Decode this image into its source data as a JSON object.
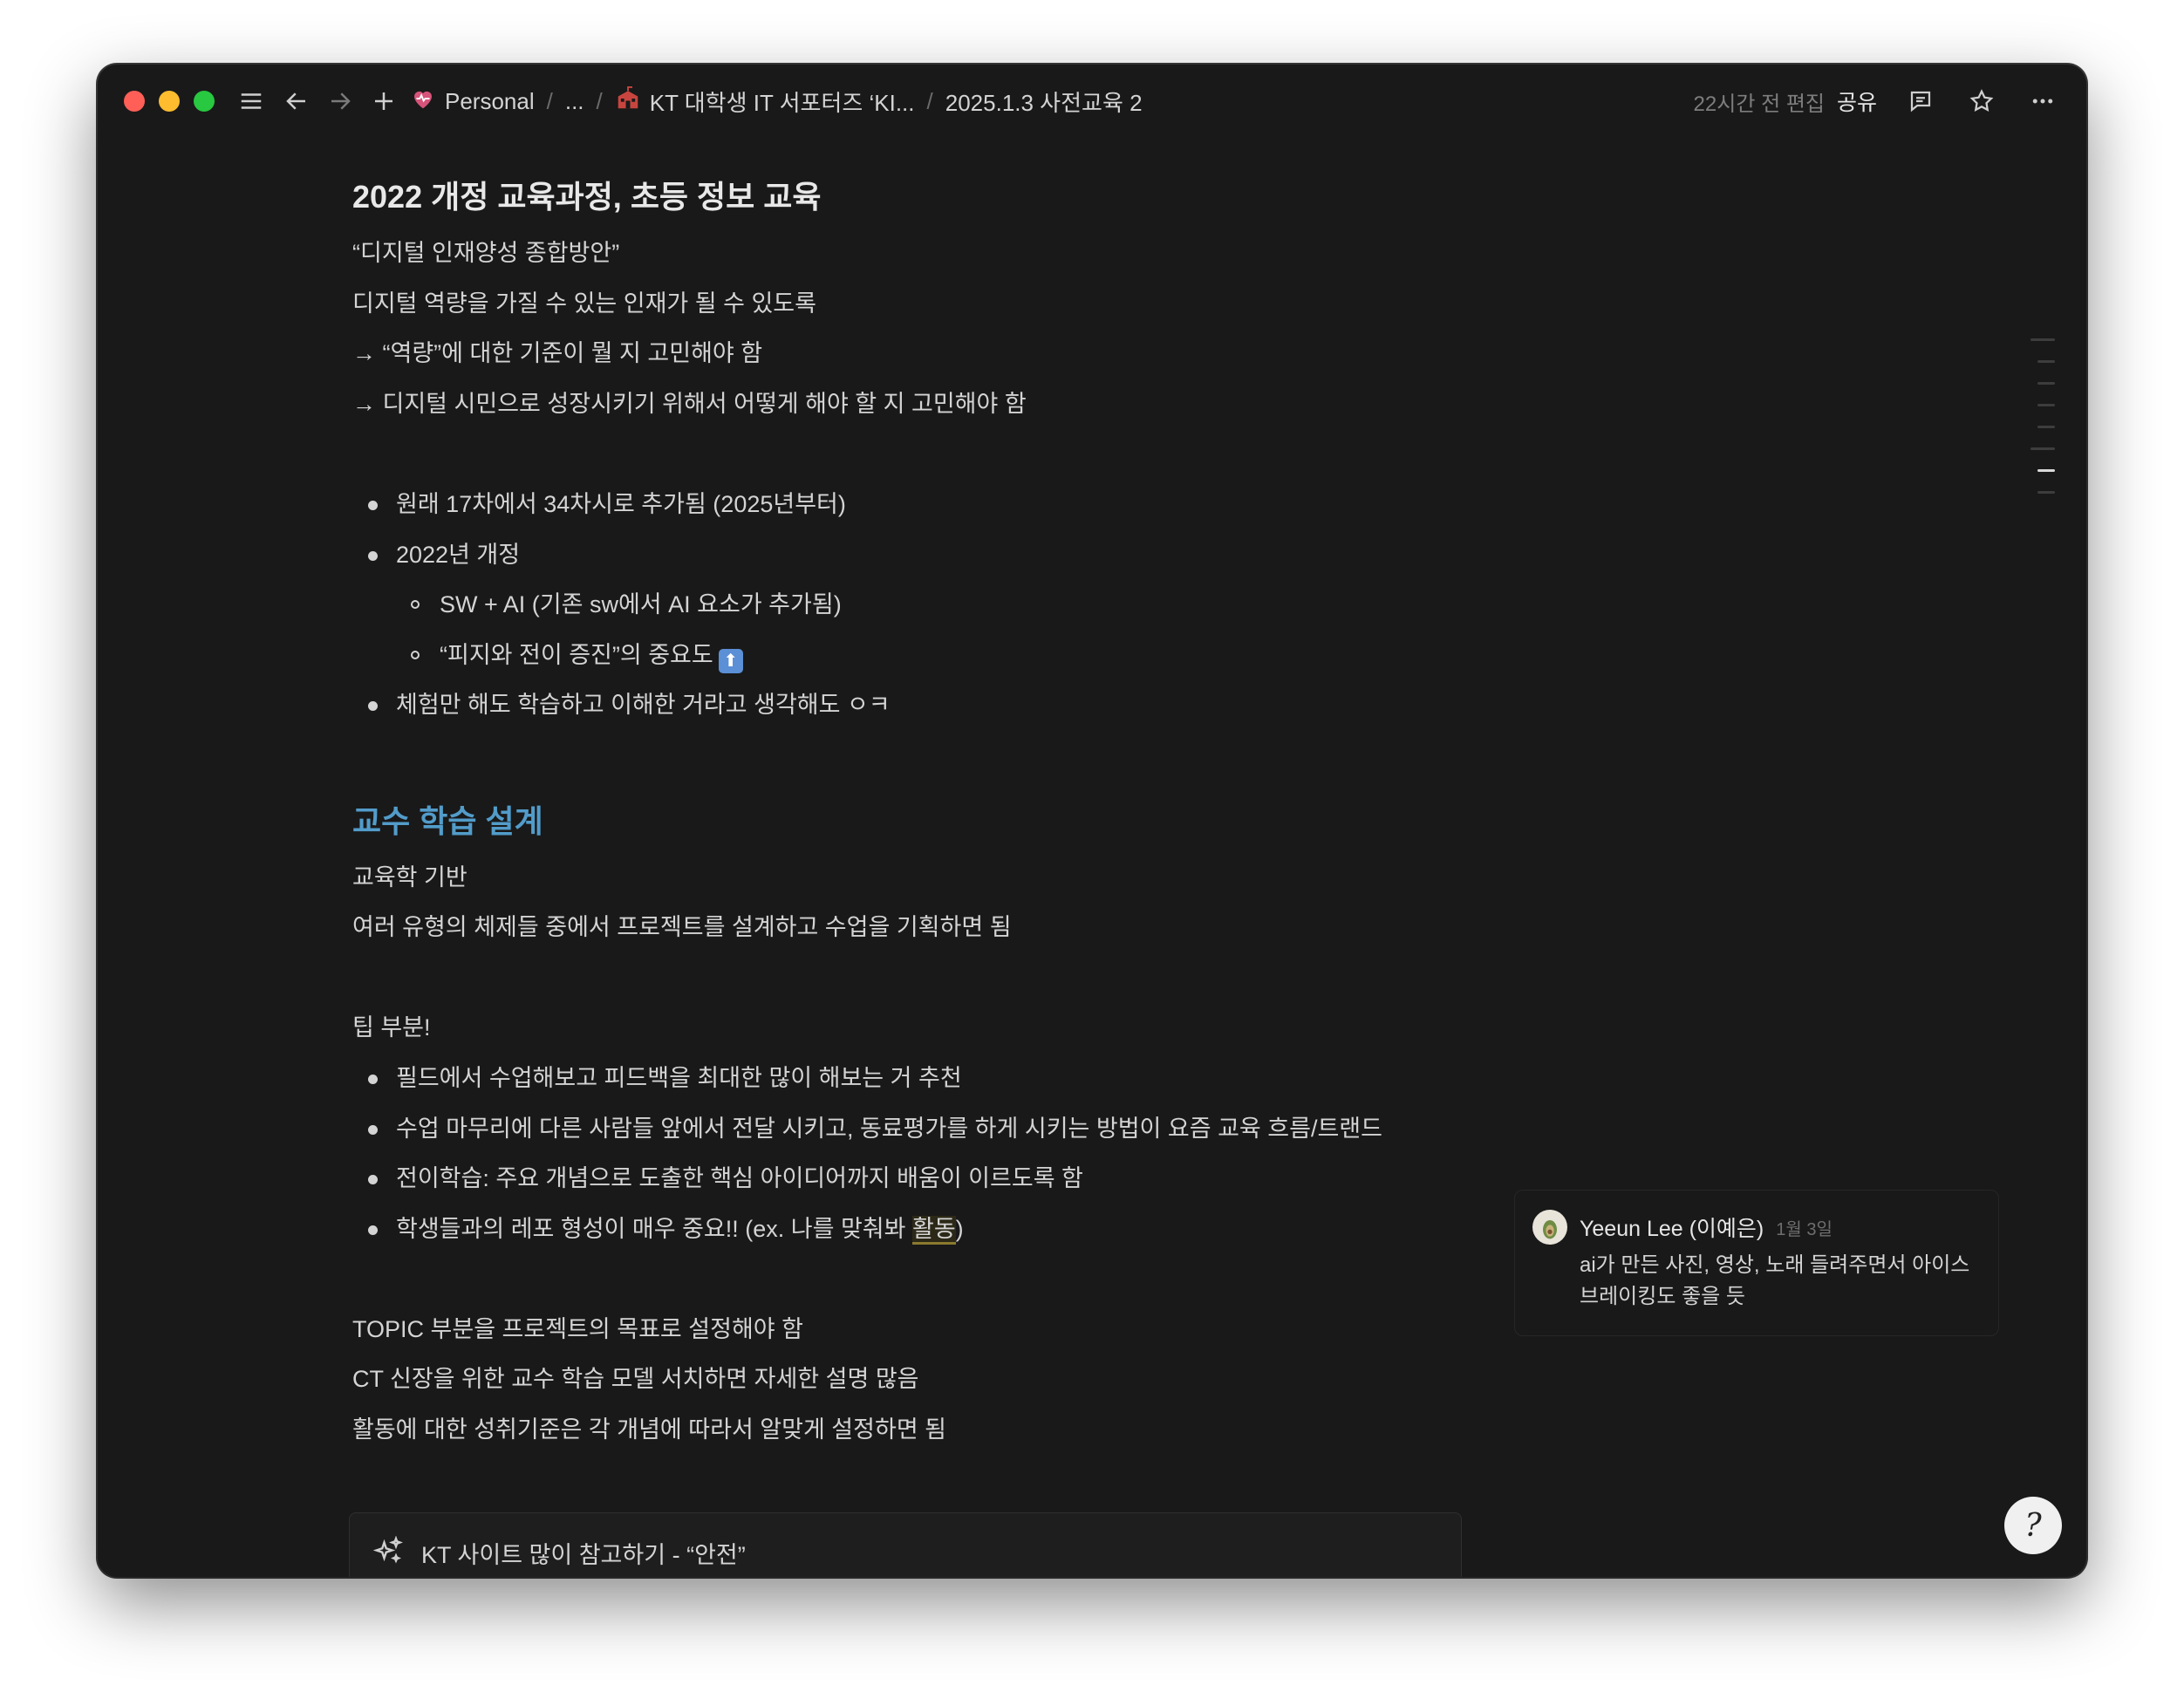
{
  "titlebar": {
    "breadcrumb": {
      "workspace": "Personal",
      "ellipsis": "...",
      "parent": "KT 대학생 IT 서포터즈 ‘KI...",
      "current": "2025.1.3 사전교육 2"
    },
    "edited": "22시간 전 편집",
    "share": "공유",
    "icons": [
      "menu-icon",
      "back-arrow-icon",
      "forward-arrow-icon",
      "plus-icon",
      "heart-icon",
      "school-icon",
      "comment-icon",
      "star-icon",
      "more-icon"
    ]
  },
  "doc": {
    "heading1": "2022 개정 교육과정, 초등 정보 교육",
    "lines1": [
      "“디지털 인재양성 종합방안”",
      "디지털 역량을 가질 수 있는 인재가 될 수 있도록",
      "→ “역량”에 대한 기준이 뭘 지 고민해야 함",
      "→ 디지털 시민으로 성장시키기 위해서 어떻게 해야 할 지 고민해야 함"
    ],
    "bullets1": {
      "b1": "원래 17차에서 34차시로 추가됨 (2025년부터)",
      "b2": "2022년 개정",
      "sub1": "SW + AI (기존 sw에서 AI 요소가 추가됨)",
      "sub2": "“피지와 전이 증진”의 중요도",
      "sub2_emoji": "⬆",
      "b3": "체험만 해도 학습하고 이해한 거라고 생각해도 ㅇㅋ"
    },
    "heading2": "교수 학습 설계",
    "lines2": [
      "교육학 기반",
      "여러 유형의 체제들 중에서 프로젝트를 설계하고 수업을 기획하면 됨"
    ],
    "tip_title": "팁 부분!",
    "tips": [
      "필드에서 수업해보고 피드백을 최대한 많이 해보는 거 추천",
      "수업 마무리에 다른 사람들 앞에서 전달 시키고, 동료평가를 하게 시키는 방법이 요즘 교육 흐름/트랜드",
      "전이학습: 주요 개념으로 도출한 핵심 아이디어까지 배움이 이르도록 함"
    ],
    "tip4_pre": "학생들과의 레포 형성이 매우 중요!! (ex. 나를 맞춰봐 ",
    "tip4_highlight": "활동",
    "tip4_post": ")",
    "lines3": [
      "TOPIC 부분을 프로젝트의 목표로 설정해야 함",
      "CT 신장을 위한 교수 학습 모델 서치하면 자세한 설명 많음",
      "활동에 대한 성취기준은 각 개념에 따라서 알맞게 설정하면 됨"
    ],
    "callout": "KT 사이트 많이 참고하기 - “안전”"
  },
  "comment": {
    "author": "Yeeun Lee (이예은)",
    "date": "1월 3일",
    "text_line1": "ai가 만든 사진, 영상, 노래 들려주면서 아이스",
    "text_line2": "브레이킹도 좋을 듯"
  },
  "colors": {
    "background": "#191919",
    "text": "#d4d4d4",
    "heading_blue": "#529cca"
  }
}
